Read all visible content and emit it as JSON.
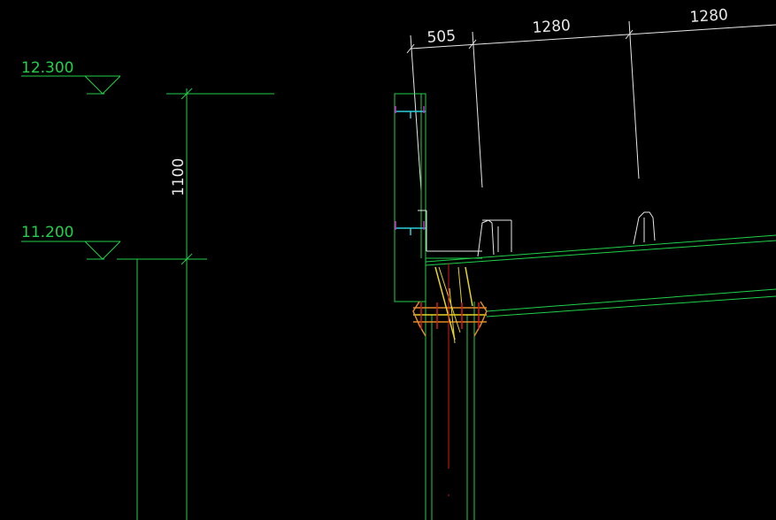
{
  "drawing": {
    "background": "#000000",
    "colors": {
      "green": "#22d14a",
      "white": "#e8e8e8",
      "yellow": "#e6d422",
      "orange": "#e08a2a",
      "red": "#d81818",
      "cyan": "#2ad0d8",
      "magenta": "#c82ac8"
    }
  },
  "levels": {
    "top": "12.300",
    "bottom": "11.200"
  },
  "height_dimension": "1100",
  "horizontal_dimensions": [
    "505",
    "1280",
    "1280"
  ]
}
